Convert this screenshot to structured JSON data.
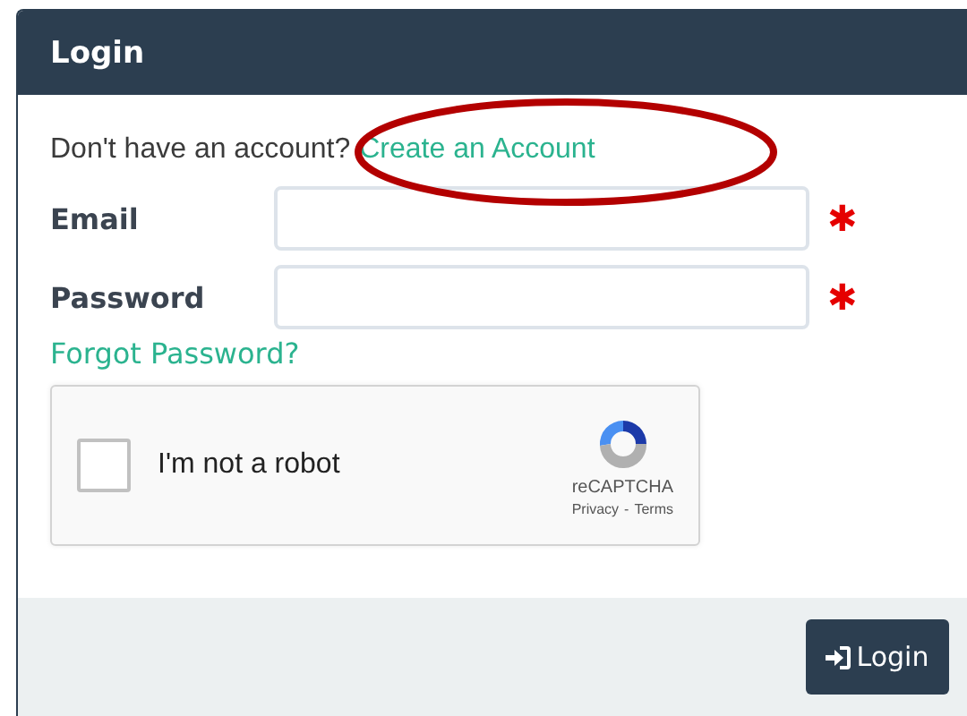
{
  "panel": {
    "title": "Login"
  },
  "signup": {
    "prompt": "Don't have an account?",
    "link": "Create an Account",
    "highlighted": true
  },
  "fields": [
    {
      "label": "Email",
      "required": true,
      "required_mark": "✱"
    },
    {
      "label": "Password",
      "required": true,
      "required_mark": "✱"
    }
  ],
  "forgot_link": "Forgot Password?",
  "captcha": {
    "label": "I'm not a robot",
    "checked": false,
    "brand": "reCAPTCHA",
    "privacy": "Privacy",
    "separator": "-",
    "terms": "Terms"
  },
  "submit": {
    "label": "Login"
  }
}
